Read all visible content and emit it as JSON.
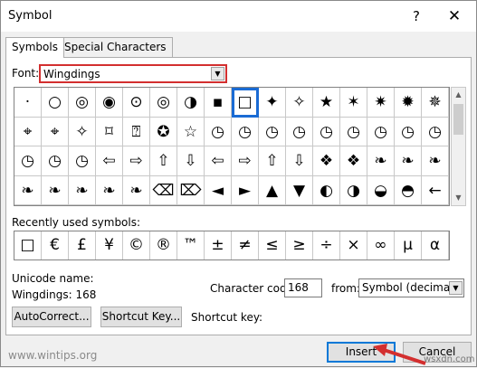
{
  "window": {
    "title": "Symbol",
    "help_glyph": "?",
    "close_glyph": "✕"
  },
  "tabs": [
    {
      "label": "Symbols"
    },
    {
      "label": "Special Characters"
    }
  ],
  "font": {
    "label": "Font:",
    "value": "Wingdings"
  },
  "symbol_grid": {
    "selected_index": 8,
    "rows": [
      [
        "·",
        "○",
        "◎",
        "◉",
        "⊙",
        "◎",
        "◑",
        "▪",
        "□",
        "✦",
        "✧",
        "★",
        "✶",
        "✷",
        "✹",
        "✵"
      ],
      [
        "⌖",
        "⌖",
        "✧",
        "⌑",
        "⍰",
        "✪",
        "☆",
        "◷",
        "◷",
        "◷",
        "◷",
        "◷",
        "◷",
        "◷",
        "◷",
        "◷"
      ],
      [
        "◷",
        "◷",
        "◷",
        "⇦",
        "⇨",
        "⇧",
        "⇩",
        "⇦",
        "⇨",
        "⇧",
        "⇩",
        "❖",
        "❖",
        "❧",
        "❧",
        "❧"
      ],
      [
        "❧",
        "❧",
        "❧",
        "❧",
        "❧",
        "⌫",
        "⌦",
        "◄",
        "►",
        "▲",
        "▼",
        "◐",
        "◑",
        "◒",
        "◓",
        "←"
      ]
    ]
  },
  "recent": {
    "label": "Recently used symbols:",
    "items": [
      "□",
      "€",
      "£",
      "¥",
      "©",
      "®",
      "™",
      "±",
      "≠",
      "≤",
      "≥",
      "÷",
      "×",
      "∞",
      "µ",
      "α"
    ]
  },
  "unicode_name_label": "Unicode name:",
  "unicode_name_value": "Wingdings: 168",
  "character_code": {
    "label": "Character code:",
    "value": "168"
  },
  "from": {
    "label": "from:",
    "value": "Symbol (decimal)"
  },
  "buttons": {
    "autocorrect": "AutoCorrect...",
    "shortcut_key": "Shortcut Key...",
    "insert": "Insert",
    "cancel": "Cancel"
  },
  "shortcut_key_label": "Shortcut key:",
  "watermark": "www.wintips.org",
  "watermark2": "wsxdn.com",
  "colors": {
    "annotation_red": "#d32f2f",
    "selection_blue": "#1a6bd4",
    "focus_blue": "#0078d7"
  }
}
